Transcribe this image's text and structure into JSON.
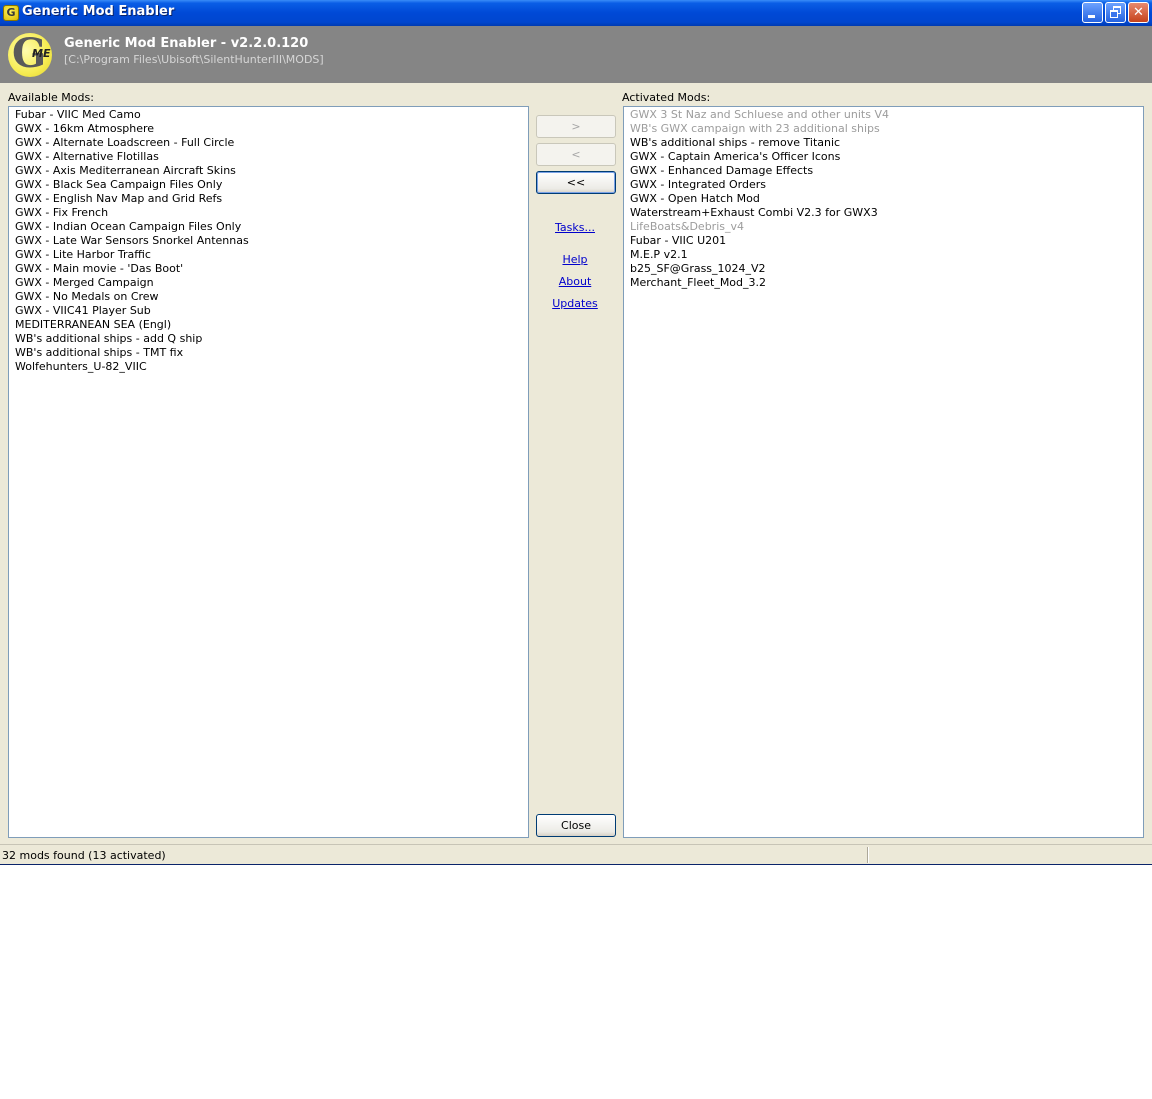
{
  "window": {
    "title": "Generic Mod Enabler"
  },
  "banner": {
    "logo_letter": "G",
    "logo_suffix": "ME",
    "app_name": "Generic Mod Enabler - v2.2.0.120",
    "mods_path": "[C:\\Program Files\\Ubisoft\\SilentHunterIII\\MODS]"
  },
  "available": {
    "label": "Available Mods:",
    "items": [
      "Fubar - VIIC Med Camo",
      "GWX - 16km Atmosphere",
      "GWX - Alternate Loadscreen - Full Circle",
      "GWX - Alternative Flotillas",
      "GWX - Axis Mediterranean Aircraft Skins",
      "GWX - Black Sea Campaign Files Only",
      "GWX - English Nav Map and Grid Refs",
      "GWX - Fix French",
      "GWX - Indian Ocean Campaign Files Only",
      "GWX - Late War Sensors Snorkel Antennas",
      "GWX - Lite Harbor Traffic",
      "GWX - Main movie - 'Das Boot'",
      "GWX - Merged Campaign",
      "GWX - No Medals on Crew",
      "GWX - VIIC41 Player Sub",
      "MEDITERRANEAN SEA  (Engl)",
      "WB's additional ships - add Q ship",
      "WB's additional ships - TMT fix",
      "Wolfehunters_U-82_VIIC"
    ]
  },
  "activated": {
    "label": "Activated Mods:",
    "items": [
      {
        "text": "GWX 3 St Naz and Schluese and other units V4",
        "dim": true
      },
      {
        "text": "WB's GWX campaign with 23 additional ships",
        "dim": true
      },
      {
        "text": "WB's additional ships - remove Titanic",
        "dim": false
      },
      {
        "text": "GWX - Captain America's Officer Icons",
        "dim": false
      },
      {
        "text": "GWX - Enhanced Damage Effects",
        "dim": false
      },
      {
        "text": "GWX - Integrated Orders",
        "dim": false
      },
      {
        "text": "GWX - Open Hatch Mod",
        "dim": false
      },
      {
        "text": "Waterstream+Exhaust Combi V2.3 for GWX3",
        "dim": false
      },
      {
        "text": "LifeBoats&Debris_v4",
        "dim": true
      },
      {
        "text": "Fubar - VIIC U201",
        "dim": false
      },
      {
        "text": "M.E.P v2.1",
        "dim": false
      },
      {
        "text": "b25_SF@Grass_1024_V2",
        "dim": false
      },
      {
        "text": "Merchant_Fleet_Mod_3.2",
        "dim": false
      }
    ]
  },
  "buttons": {
    "activate": ">",
    "deactivate": "<",
    "deactivate_all": "<<",
    "close": "Close"
  },
  "links": {
    "tasks": "Tasks...",
    "help": "Help",
    "about": "About",
    "updates": "Updates"
  },
  "status": {
    "text": "32 mods found (13 activated)"
  },
  "colors": {
    "titlebar": "#0049d6",
    "banner": "#858585",
    "dim_text": "#9c9c9c",
    "link": "#0000cc"
  }
}
